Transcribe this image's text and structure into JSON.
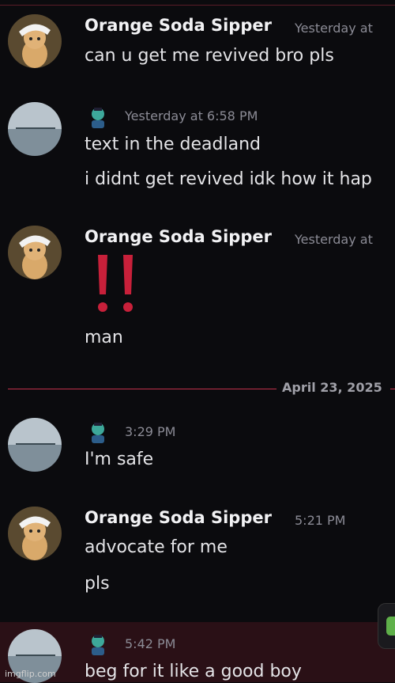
{
  "messages": [
    {
      "user": "Orange Soda Sipper",
      "time": "Yesterday at",
      "lines": [
        "can u get me revived bro pls"
      ]
    },
    {
      "user": "",
      "time": "Yesterday at 6:58 PM",
      "lines": [
        "text in the deadland",
        "i didnt get revived idk how it hap"
      ]
    },
    {
      "user": "Orange Soda Sipper",
      "time": "Yesterday at",
      "lines": [
        "man"
      ]
    },
    {
      "user": "",
      "time": "3:29 PM",
      "lines": [
        "I'm safe"
      ]
    },
    {
      "user": "Orange Soda Sipper",
      "time": "5:21 PM",
      "lines": [
        "advocate for me",
        "pls"
      ]
    },
    {
      "user": "",
      "time": "5:42 PM",
      "lines": [
        "beg for it like a good boy"
      ]
    }
  ],
  "date_divider": "April 23, 2025",
  "watermark": "imgflip.com",
  "colors": {
    "background": "#0b0b0e",
    "divider": "#c0304a",
    "highlight": "#2a1016",
    "exclamation": "#c8203a"
  }
}
